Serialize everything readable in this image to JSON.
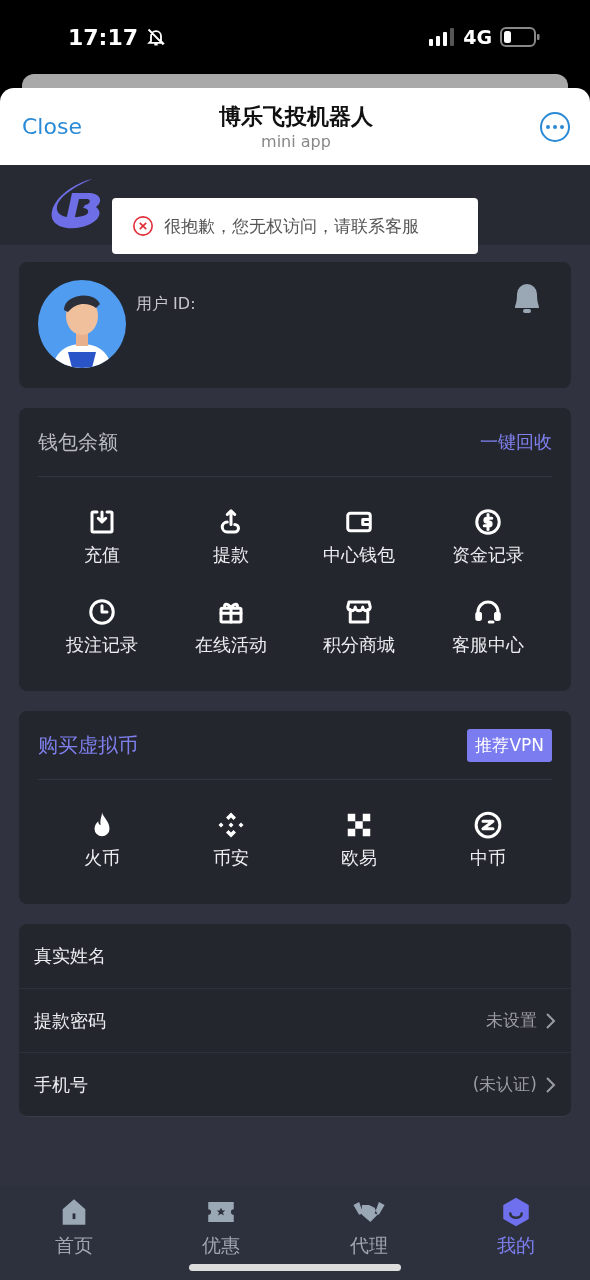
{
  "status_bar": {
    "time": "17:17",
    "network": "4G"
  },
  "header": {
    "close": "Close",
    "title": "博乐飞投机器人",
    "subtitle": "mini app"
  },
  "toast": {
    "message": "很抱歉，您无权访问，请联系客服"
  },
  "profile": {
    "user_id_label": "用户 ID:"
  },
  "wallet": {
    "title": "钱包余额",
    "action": "一键回收",
    "items": [
      {
        "label": "充值",
        "kind": "deposit"
      },
      {
        "label": "提款",
        "kind": "withdraw"
      },
      {
        "label": "中心钱包",
        "kind": "wallet"
      },
      {
        "label": "资金记录",
        "kind": "dollar"
      },
      {
        "label": "投注记录",
        "kind": "clock"
      },
      {
        "label": "在线活动",
        "kind": "gift"
      },
      {
        "label": "积分商城",
        "kind": "store"
      },
      {
        "label": "客服中心",
        "kind": "headset"
      }
    ]
  },
  "crypto": {
    "title": "购买虚拟币",
    "action": "推荐VPN",
    "items": [
      {
        "label": "火币",
        "kind": "flame"
      },
      {
        "label": "币安",
        "kind": "diamond"
      },
      {
        "label": "欧易",
        "kind": "checker"
      },
      {
        "label": "中币",
        "kind": "ring"
      }
    ]
  },
  "settings": [
    {
      "label": "真实姓名"
    },
    {
      "label": "提款密码",
      "value": "未设置"
    },
    {
      "label": "手机号",
      "value": "(未认证)"
    }
  ],
  "tab_bar": [
    {
      "label": "首页",
      "kind": "home",
      "selected": false
    },
    {
      "label": "优惠",
      "kind": "ticket",
      "selected": false
    },
    {
      "label": "代理",
      "kind": "handshake",
      "selected": false
    },
    {
      "label": "我的",
      "kind": "user",
      "selected": true
    }
  ]
}
